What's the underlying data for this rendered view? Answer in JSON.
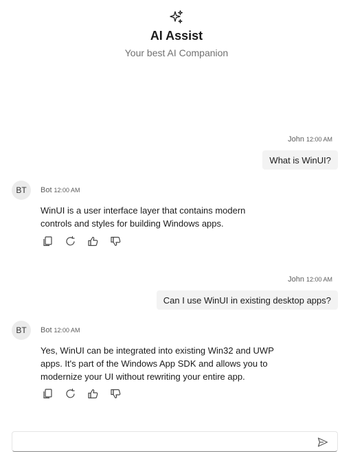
{
  "header": {
    "icon": "sparkle-icon",
    "title": "AI Assist",
    "subtitle": "Your best AI Companion"
  },
  "messages": [
    {
      "role": "user",
      "author": "John",
      "time": "12:00 AM",
      "text": "What is WinUI?"
    },
    {
      "role": "bot",
      "avatar": "BT",
      "author": "Bot",
      "time": "12:00 AM",
      "text": "WinUI is a user interface layer that contains modern controls and styles for building Windows apps."
    },
    {
      "role": "user",
      "author": "John",
      "time": "12:00 AM",
      "text": "Can I use WinUI in existing desktop apps?"
    },
    {
      "role": "bot",
      "avatar": "BT",
      "author": "Bot",
      "time": "12:00 AM",
      "text": "Yes, WinUI can be integrated into existing Win32 and UWP apps. It's part of the Windows App SDK and allows you to modernize your UI without rewriting your entire app."
    }
  ],
  "message_actions": [
    "copy-icon",
    "regenerate-icon",
    "thumbs-up-icon",
    "thumbs-down-icon"
  ],
  "composer": {
    "value": "",
    "placeholder": "",
    "send_icon": "send-icon"
  }
}
